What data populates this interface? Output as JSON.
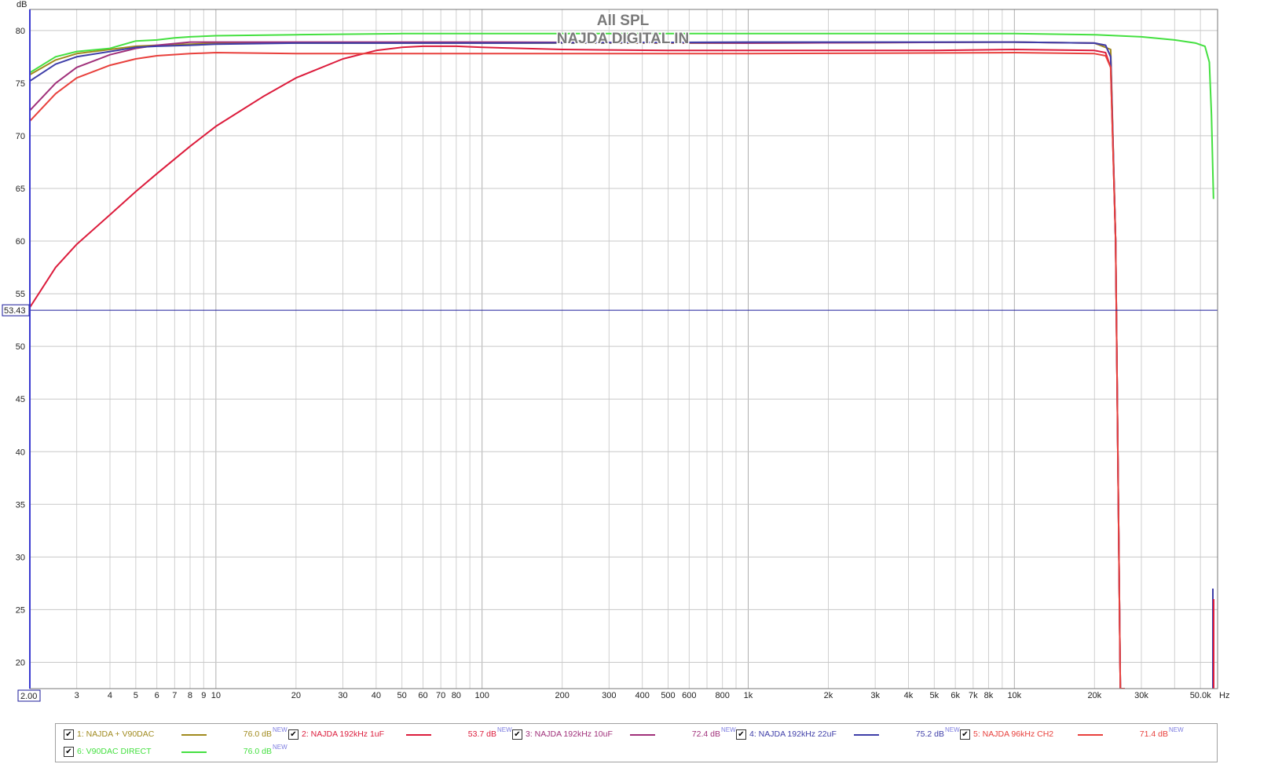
{
  "chart_data": {
    "type": "line",
    "title": "All SPL",
    "subtitle": "NAJDA DIGITAL IN",
    "ylabel": "dB",
    "xunit": "Hz",
    "xscale": "log",
    "xlim": [
      2,
      58000
    ],
    "ylim": [
      17.5,
      82
    ],
    "grid": true,
    "legend_position": "bottom",
    "cursor_y": 53.43,
    "cursor_y_label": "53.43",
    "x_start_label": "2.00",
    "y_ticks": [
      {
        "v": 20,
        "label": "20"
      },
      {
        "v": 25,
        "label": "25"
      },
      {
        "v": 30,
        "label": "30"
      },
      {
        "v": 35,
        "label": "35"
      },
      {
        "v": 40,
        "label": "40"
      },
      {
        "v": 45,
        "label": "45"
      },
      {
        "v": 50,
        "label": "50"
      },
      {
        "v": 55,
        "label": "55"
      },
      {
        "v": 60,
        "label": "60"
      },
      {
        "v": 65,
        "label": "65"
      },
      {
        "v": 70,
        "label": "70"
      },
      {
        "v": 75,
        "label": "75"
      },
      {
        "v": 80,
        "label": "80"
      }
    ],
    "x_ticks": [
      {
        "v": 3,
        "label": "3"
      },
      {
        "v": 4,
        "label": "4"
      },
      {
        "v": 5,
        "label": "5"
      },
      {
        "v": 6,
        "label": "6"
      },
      {
        "v": 7,
        "label": "7"
      },
      {
        "v": 8,
        "label": "8"
      },
      {
        "v": 9,
        "label": "9"
      },
      {
        "v": 10,
        "label": "10"
      },
      {
        "v": 20,
        "label": "20"
      },
      {
        "v": 30,
        "label": "30"
      },
      {
        "v": 40,
        "label": "40"
      },
      {
        "v": 50,
        "label": "50"
      },
      {
        "v": 60,
        "label": "60"
      },
      {
        "v": 70,
        "label": "70"
      },
      {
        "v": 80,
        "label": "80"
      },
      {
        "v": 100,
        "label": "100"
      },
      {
        "v": 200,
        "label": "200"
      },
      {
        "v": 300,
        "label": "300"
      },
      {
        "v": 400,
        "label": "400"
      },
      {
        "v": 500,
        "label": "500"
      },
      {
        "v": 600,
        "label": "600"
      },
      {
        "v": 800,
        "label": "800"
      },
      {
        "v": 1000,
        "label": "1k"
      },
      {
        "v": 2000,
        "label": "2k"
      },
      {
        "v": 3000,
        "label": "3k"
      },
      {
        "v": 4000,
        "label": "4k"
      },
      {
        "v": 5000,
        "label": "5k"
      },
      {
        "v": 6000,
        "label": "6k"
      },
      {
        "v": 7000,
        "label": "7k"
      },
      {
        "v": 8000,
        "label": "8k"
      },
      {
        "v": 10000,
        "label": "10k"
      },
      {
        "v": 20000,
        "label": "20k"
      },
      {
        "v": 30000,
        "label": "30k"
      },
      {
        "v": 50000,
        "label": "50.0k"
      }
    ],
    "series": [
      {
        "name": "1: NAJDA + V90DAC",
        "color": "#a08a1e",
        "value_label": "76.0 dB",
        "x": [
          2,
          2.5,
          3,
          4,
          5,
          6,
          8,
          10,
          20,
          50,
          100,
          1000,
          10000,
          20000,
          23000,
          24000,
          25000,
          26000
        ],
        "y": [
          75.8,
          77.2,
          77.8,
          78.2,
          78.5,
          78.6,
          78.7,
          78.8,
          78.8,
          78.8,
          78.8,
          78.8,
          78.9,
          78.8,
          78.2,
          60,
          17.5,
          17.5
        ]
      },
      {
        "name": "2: NAJDA 192kHz 1uF",
        "color": "#dc1c3c",
        "value_label": "53.7 dB",
        "x": [
          2,
          2.5,
          3,
          4,
          5,
          6,
          8,
          10,
          15,
          20,
          30,
          40,
          50,
          60,
          80,
          100,
          200,
          500,
          1000,
          5000,
          10000,
          20000,
          22000,
          23000,
          24000,
          25000,
          26000
        ],
        "y": [
          53.7,
          57.5,
          59.7,
          62.5,
          64.7,
          66.4,
          69.0,
          70.9,
          73.7,
          75.5,
          77.3,
          78.1,
          78.4,
          78.5,
          78.5,
          78.4,
          78.2,
          78.1,
          78.1,
          78.1,
          78.2,
          78.1,
          77.9,
          76.5,
          60,
          17.5,
          17.5
        ]
      },
      {
        "name": "3: NAJDA 192kHz 10uF",
        "color": "#a0307a",
        "value_label": "72.4 dB",
        "x": [
          2,
          2.5,
          3,
          4,
          5,
          6,
          8,
          10,
          20,
          50,
          100,
          1000,
          10000,
          20000,
          22000,
          23000,
          24000,
          25000,
          26000
        ],
        "y": [
          72.4,
          75.0,
          76.5,
          77.7,
          78.3,
          78.6,
          78.9,
          78.9,
          78.9,
          78.9,
          78.9,
          78.8,
          78.9,
          78.8,
          78.6,
          77.5,
          60,
          17.5,
          17.5
        ]
      },
      {
        "name": "4: NAJDA 192kHz 22uF",
        "color": "#3e3ea8",
        "value_label": "75.2 dB",
        "x": [
          2,
          2.5,
          3,
          4,
          5,
          6,
          8,
          10,
          20,
          50,
          100,
          1000,
          10000,
          20000,
          22000,
          23000,
          24000,
          25000,
          26000
        ],
        "y": [
          75.2,
          76.8,
          77.5,
          78.0,
          78.4,
          78.5,
          78.6,
          78.7,
          78.8,
          78.8,
          78.8,
          78.9,
          78.9,
          78.8,
          78.6,
          77.5,
          60,
          17.5,
          17.5
        ]
      },
      {
        "name": "5: NAJDA 96kHz CH2",
        "color": "#e8403c",
        "value_label": "71.4 dB",
        "x": [
          2,
          2.5,
          3,
          4,
          5,
          6,
          8,
          10,
          20,
          50,
          100,
          1000,
          10000,
          20000,
          22000,
          23000,
          24000,
          25000,
          26000
        ],
        "y": [
          71.4,
          74.0,
          75.5,
          76.7,
          77.3,
          77.6,
          77.8,
          77.9,
          77.8,
          77.8,
          77.8,
          77.8,
          77.9,
          77.8,
          77.6,
          76.5,
          60,
          17.5,
          17.5
        ]
      },
      {
        "name": "6: V90DAC DIRECT",
        "color": "#44e040",
        "value_label": "76.0 dB",
        "x": [
          2,
          2.5,
          3,
          4,
          5,
          6,
          7,
          8,
          10,
          20,
          50,
          100,
          1000,
          10000,
          20000,
          30000,
          40000,
          48000,
          52000,
          54000,
          55000,
          56000
        ],
        "y": [
          76.0,
          77.5,
          78.0,
          78.3,
          79.0,
          79.1,
          79.3,
          79.4,
          79.5,
          79.6,
          79.7,
          79.7,
          79.7,
          79.7,
          79.6,
          79.4,
          79.1,
          78.8,
          78.5,
          77.0,
          72.0,
          64.0
        ]
      }
    ]
  },
  "legend": {
    "new_tag": "NEW",
    "checkbox_glyph": "✔"
  }
}
